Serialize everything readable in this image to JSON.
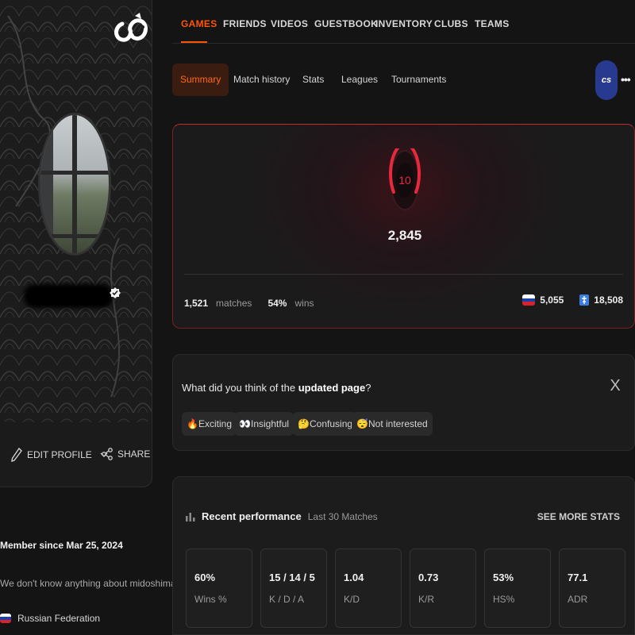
{
  "nav": {
    "items": [
      "GAMES",
      "FRIENDS",
      "VIDEOS",
      "GUESTBOOK",
      "INVENTORY",
      "CLUBS",
      "TEAMS"
    ],
    "active_index": 0
  },
  "sub_tabs": {
    "items": [
      "Summary",
      "Match history",
      "Stats",
      "Leagues",
      "Tournaments"
    ],
    "active_index": 0,
    "game_icon_text": "cs",
    "more_label": "•••"
  },
  "level_card": {
    "level": "10",
    "elo": "2,845",
    "matches_value": "1,521",
    "matches_label": "matches",
    "wins_value": "54%",
    "wins_label": "wins",
    "country_rank": "5,055",
    "region_rank": "18,508"
  },
  "feedback": {
    "question_prefix": "What did you think of the ",
    "question_bold": "updated page",
    "question_suffix": "?",
    "close_label": "X",
    "options": [
      {
        "emoji": "🔥",
        "label": "Exciting"
      },
      {
        "emoji": "👀",
        "label": "Insightful"
      },
      {
        "emoji": "🤔",
        "label": "Confusing"
      },
      {
        "emoji": "😴",
        "label": "Not interested"
      }
    ]
  },
  "performance": {
    "title": "Recent performance",
    "subtitle": "Last 30 Matches",
    "see_more": "SEE MORE STATS",
    "stats": [
      {
        "value": "60%",
        "label": "Wins %"
      },
      {
        "value": "15 / 14 / 5",
        "label": "K / D / A"
      },
      {
        "value": "1.04",
        "label": "K/D"
      },
      {
        "value": "0.73",
        "label": "K/R"
      },
      {
        "value": "53%",
        "label": "HS%"
      },
      {
        "value": "77.1",
        "label": "ADR"
      }
    ]
  },
  "profile": {
    "edit_label": "EDIT PROFILE",
    "share_label": "SHARE",
    "member_since": "Member since Mar 25, 2024",
    "bio": "We don't know anything about midoshima",
    "country": "Russian Federation"
  },
  "colors": {
    "accent": "#ff5500",
    "level_red": "#e8283c",
    "background": "#141414",
    "card": "#1c1c1c"
  }
}
